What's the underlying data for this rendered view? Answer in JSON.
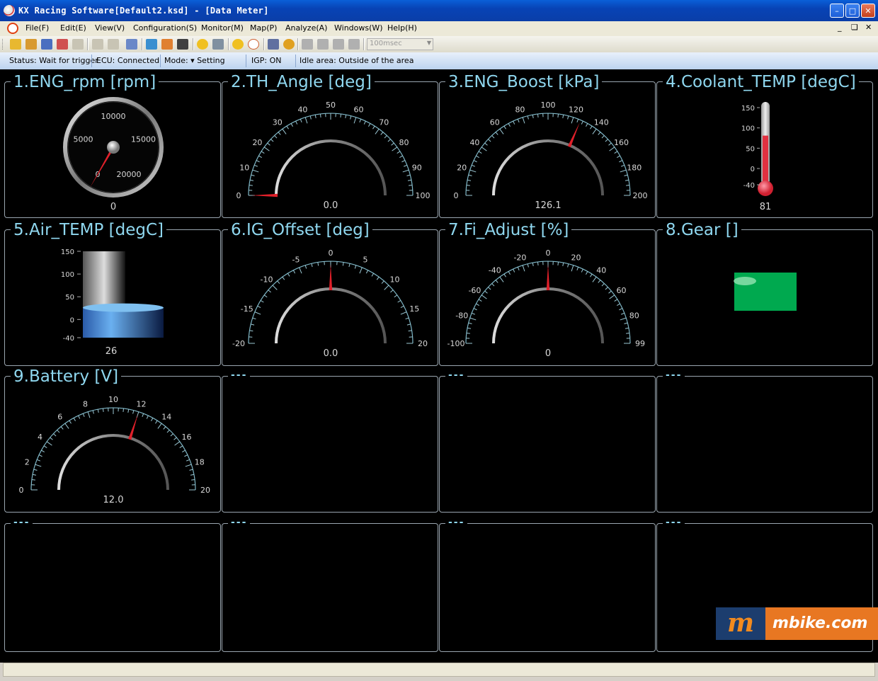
{
  "window": {
    "title": "KX Racing Software[Default2.ksd] - [Data Meter]"
  },
  "menu": {
    "items": [
      "File(F)",
      "Edit(E)",
      "View(V)",
      "Configuration(S)",
      "Monitor(M)",
      "Map(P)",
      "Analyze(A)",
      "Windows(W)",
      "Help(H)"
    ]
  },
  "toolbar": {
    "interval": "100msec"
  },
  "status": {
    "status": "Status: Wait for trigger",
    "ecu": "ECU:  Connected",
    "mode": "Mode: ▾ Setting",
    "igp": "IGP:  ON",
    "idle": "Idle area: Outside of the area"
  },
  "panels": [
    {
      "title": "1.ENG_rpm [rpm]",
      "value": "0",
      "type": "rpm",
      "ticks": [
        "0",
        "5000",
        "10000",
        "15000",
        "20000"
      ],
      "min": 0,
      "max": 20000,
      "reading": 0
    },
    {
      "title": "2.TH_Angle [deg]",
      "value": "0.0",
      "type": "arc",
      "ticks": [
        "0",
        "10",
        "20",
        "30",
        "40",
        "50",
        "60",
        "70",
        "80",
        "90",
        "100"
      ],
      "min": 0,
      "max": 100,
      "reading": 0
    },
    {
      "title": "3.ENG_Boost [kPa]",
      "value": "126.1",
      "type": "arc",
      "ticks": [
        "0",
        "20",
        "40",
        "60",
        "80",
        "100",
        "120",
        "140",
        "160",
        "180",
        "200"
      ],
      "min": 0,
      "max": 200,
      "reading": 126.1
    },
    {
      "title": "4.Coolant_TEMP [degC]",
      "value": "81",
      "type": "thermo",
      "ticks": [
        "150",
        "100",
        "50",
        "0",
        "-40"
      ],
      "min": -40,
      "max": 150,
      "reading": 81
    },
    {
      "title": "5.Air_TEMP [degC]",
      "value": "26",
      "type": "cylinder",
      "ticks": [
        "150",
        "100",
        "50",
        "0",
        "-40"
      ],
      "min": -40,
      "max": 150,
      "reading": 26
    },
    {
      "title": "6.IG_Offset [deg]",
      "value": "0.0",
      "type": "arc",
      "ticks": [
        "-20",
        "-15",
        "-10",
        "-5",
        "0",
        "5",
        "10",
        "15",
        "20"
      ],
      "min": -20,
      "max": 20,
      "reading": 0
    },
    {
      "title": "7.Fi_Adjust [%]",
      "value": "0",
      "type": "arc",
      "ticks": [
        "-100",
        "-80",
        "-60",
        "-40",
        "-20",
        "0",
        "20",
        "40",
        "60",
        "80",
        "99"
      ],
      "min": -100,
      "max": 100,
      "reading": 0
    },
    {
      "title": "8.Gear []",
      "value": "",
      "type": "gear",
      "color": "#00a94f"
    },
    {
      "title": "9.Battery [V]",
      "value": "12.0",
      "type": "arc",
      "ticks": [
        "0",
        "2",
        "4",
        "6",
        "8",
        "10",
        "12",
        "14",
        "16",
        "18",
        "20"
      ],
      "min": 0,
      "max": 20,
      "reading": 12.0
    },
    {
      "title": "---",
      "type": "empty"
    },
    {
      "title": "---",
      "type": "empty"
    },
    {
      "title": "---",
      "type": "empty"
    },
    {
      "title": "---",
      "type": "empty"
    },
    {
      "title": "---",
      "type": "empty"
    },
    {
      "title": "---",
      "type": "empty"
    },
    {
      "title": "---",
      "type": "empty"
    }
  ],
  "watermark": {
    "text": "mbike.com",
    "mark": "m"
  },
  "colors": {
    "accent": "#8fd7ef",
    "needle": "#e0202a",
    "gear": "#00a94f",
    "panel_border": "#9aa6b0"
  }
}
